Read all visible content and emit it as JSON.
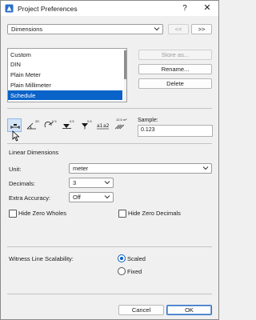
{
  "window": {
    "title": "Project Preferences",
    "help_glyph": "?",
    "close_glyph": "✕"
  },
  "category": {
    "value": "Dimensions",
    "prev_label": "<<",
    "next_label": ">>"
  },
  "standards": {
    "items": [
      "Custom",
      "DIN",
      "Plain Meter",
      "Plain Millimeter",
      "Schedule"
    ],
    "selected_index": 4
  },
  "actions": {
    "store_as": "Store as...",
    "rename": "Rename...",
    "delete": "Delete"
  },
  "dimension_types": [
    "linear-dimension",
    "angle-dimension",
    "radial-dimension",
    "level-dimension",
    "elevation-dimension",
    "area-dimension",
    "calculation-dimension"
  ],
  "dimension_type_labels": [
    "",
    "2D",
    "0.5",
    "0.5",
    "0.5",
    "",
    "12.5 m²"
  ],
  "sample": {
    "label": "Sample:",
    "value": "0.123"
  },
  "section_title": "Linear Dimensions",
  "unit": {
    "label": "Unit:",
    "value": "meter"
  },
  "decimals": {
    "label": "Decimals:",
    "value": "3"
  },
  "extra_accuracy": {
    "label": "Extra Accuracy:",
    "value": "Off"
  },
  "hide_zero_wholes": {
    "label": "Hide Zero Wholes",
    "checked": false
  },
  "hide_zero_decimals": {
    "label": "Hide Zero Decimals",
    "checked": false
  },
  "witness": {
    "label": "Witness Line Scalability:",
    "options": [
      "Scaled",
      "Fixed"
    ],
    "selected": "Scaled"
  },
  "footer": {
    "cancel": "Cancel",
    "ok": "OK"
  },
  "colors": {
    "accent": "#0a63c9",
    "selection_highlight": "#d4e4f8"
  }
}
